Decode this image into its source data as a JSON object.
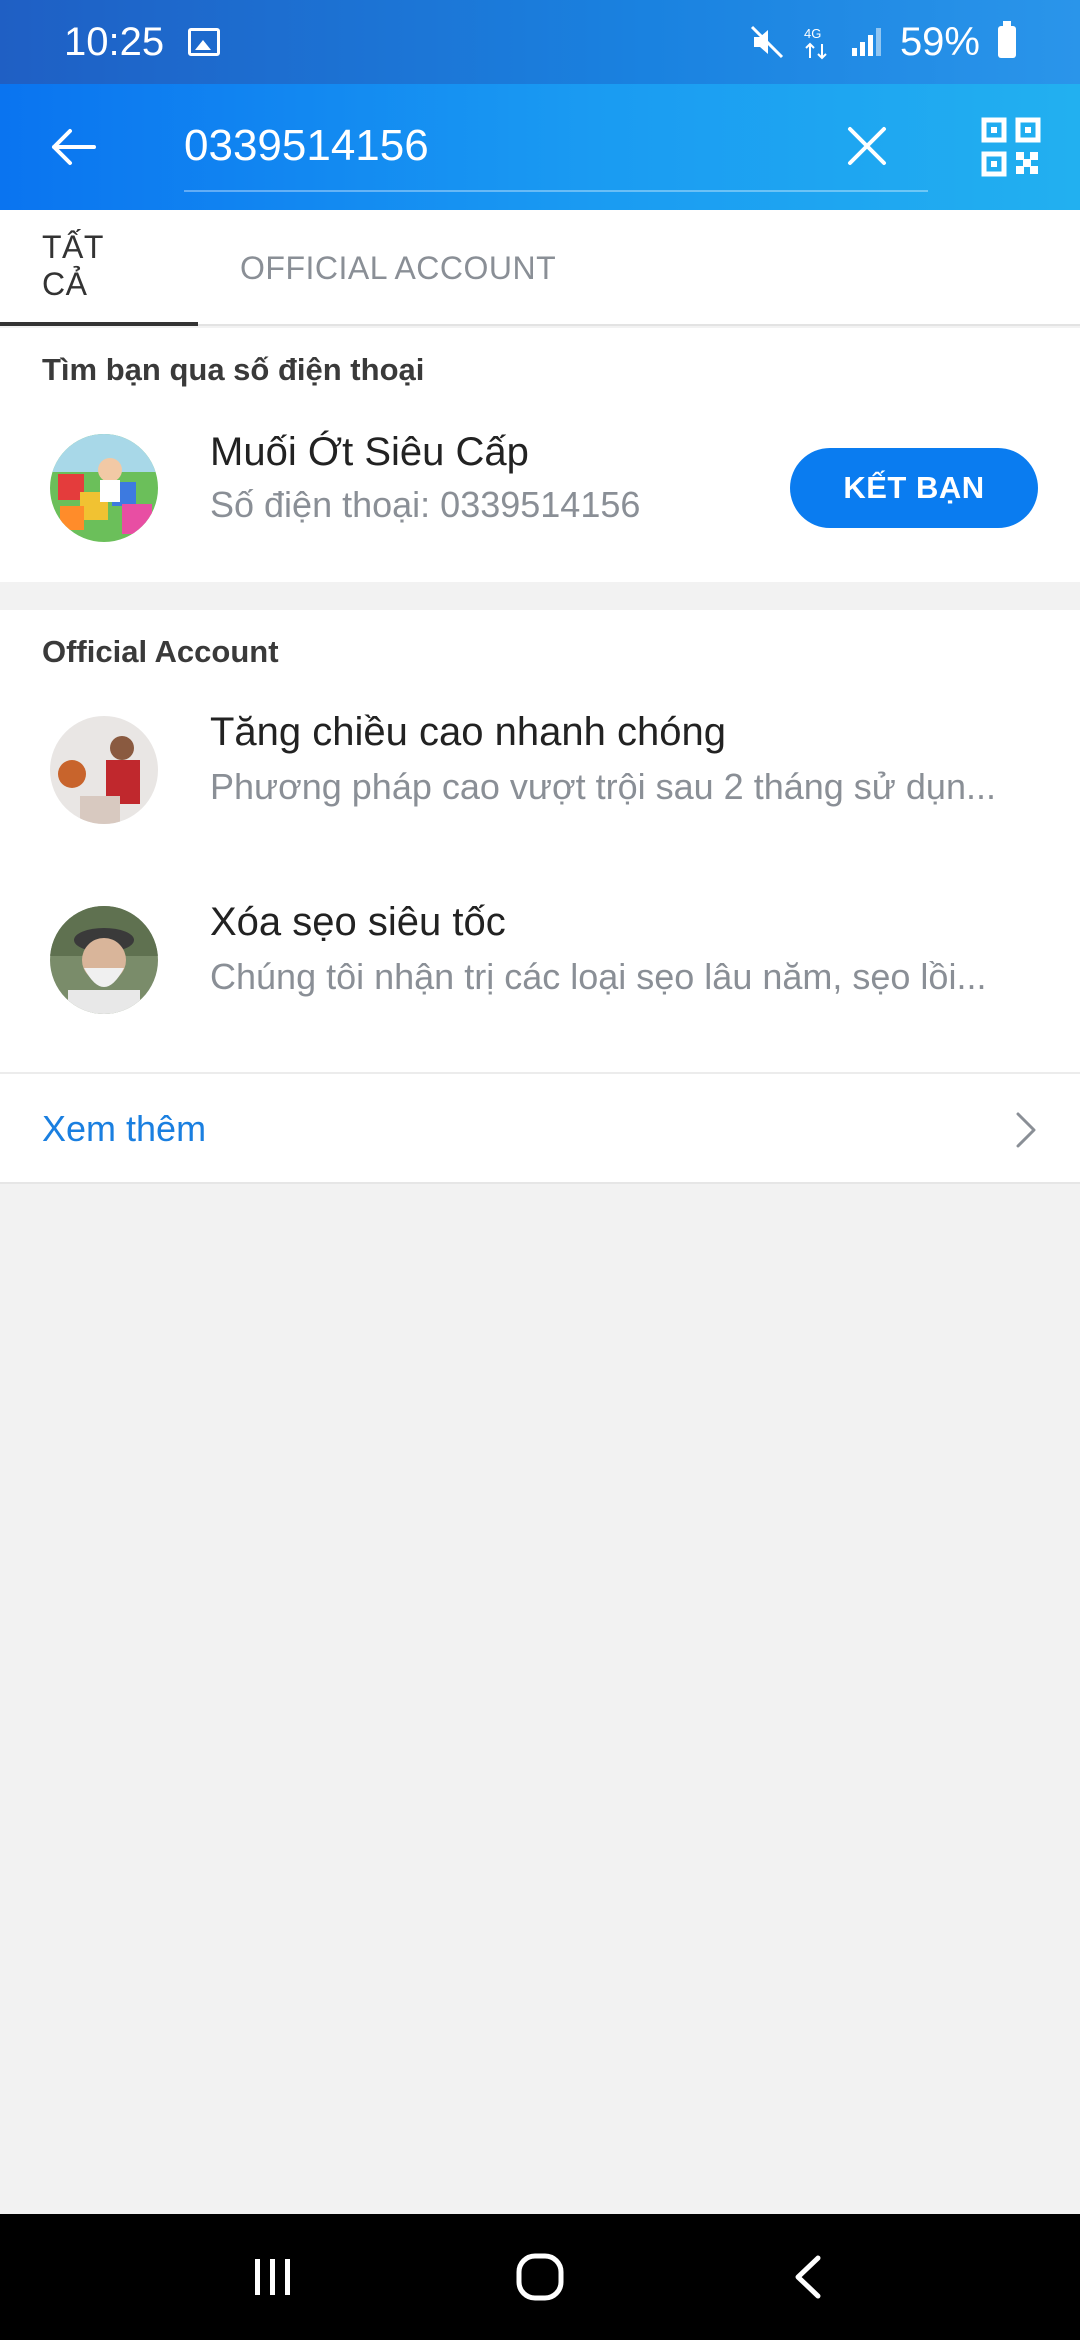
{
  "status": {
    "time": "10:25",
    "battery": "59%",
    "network": "4G"
  },
  "search": {
    "value": "0339514156"
  },
  "tabs": [
    {
      "label": "TẤT CẢ",
      "active": true
    },
    {
      "label": "OFFICIAL ACCOUNT",
      "active": false
    }
  ],
  "phone_section": {
    "title": "Tìm bạn qua số điện thoại",
    "result": {
      "name": "Muối Ớt Siêu Cấp",
      "sub": "Số điện thoại: 0339514156",
      "button_label": "KẾT BẠN"
    }
  },
  "oa_section": {
    "title": "Official Account",
    "items": [
      {
        "name": "Tăng chiều cao nhanh chóng",
        "sub": "Phương pháp cao vượt trội sau 2 tháng sử dụn..."
      },
      {
        "name": "Xóa sẹo siêu tốc",
        "sub": "Chúng tôi nhận trị các loại sẹo lâu năm, sẹo lồi..."
      }
    ],
    "more_label": "Xem thêm"
  },
  "colors": {
    "accent": "#0a7cf0",
    "link": "#1a7fe0",
    "header_start": "#0a74f0",
    "header_end": "#22b0f0"
  }
}
